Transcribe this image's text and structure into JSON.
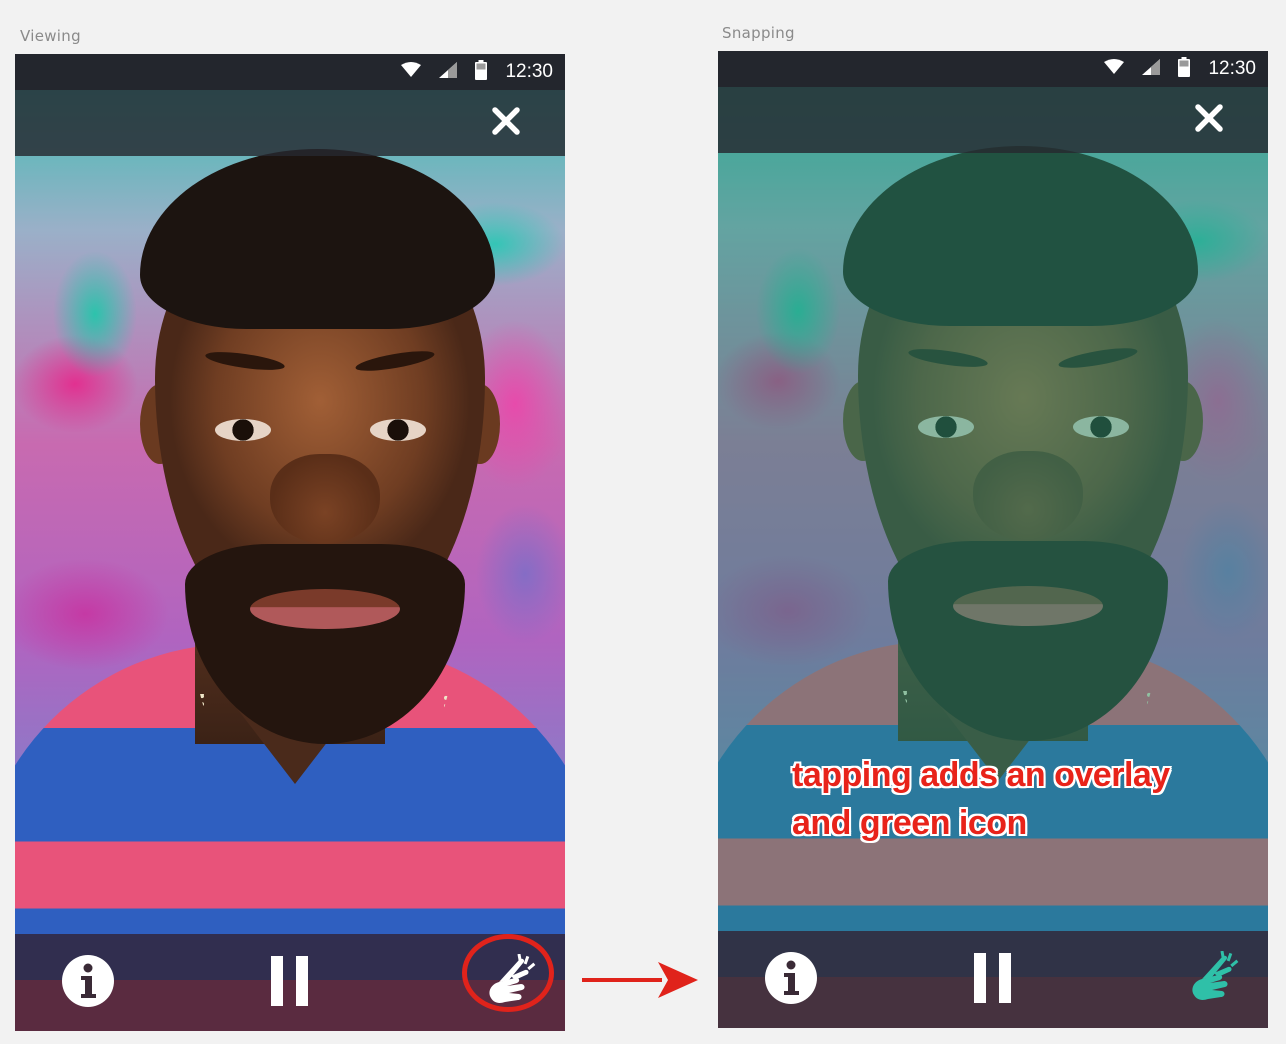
{
  "frames": [
    {
      "label": "Viewing",
      "status_time": "12:30",
      "snap_icon_color": "#ffffff",
      "overlay": false
    },
    {
      "label": "Snapping",
      "status_time": "12:30",
      "snap_icon_color": "#2fc0a8",
      "overlay": true
    }
  ],
  "annotation": {
    "line1": "tapping adds an overlay",
    "line2": "and green icon",
    "color": "#e8231a"
  },
  "icons": {
    "wifi": "wifi-icon",
    "signal": "cell-signal-icon",
    "battery": "battery-icon",
    "close": "close-icon",
    "info": "info-icon",
    "pause": "pause-icon",
    "snap": "finger-snap-icon",
    "arrow": "arrow-right-icon"
  },
  "accent_colors": {
    "highlight": "#e0231b",
    "overlay": "#2896a0"
  }
}
